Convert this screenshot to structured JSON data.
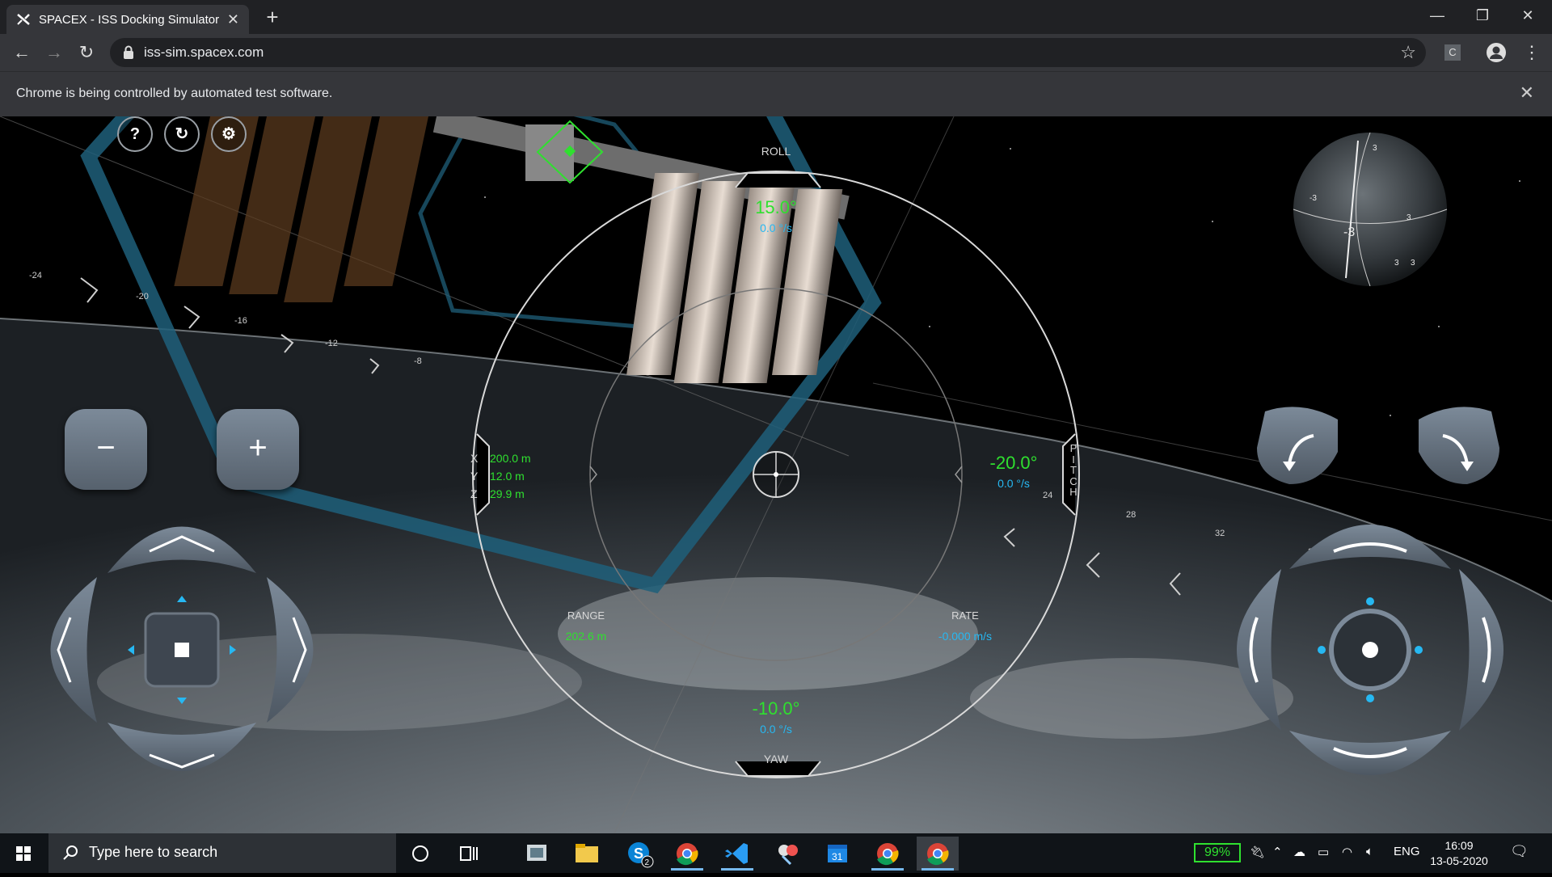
{
  "browser": {
    "tab_title": "SPACEX - ISS Docking Simulator",
    "tab_close": "✕",
    "new_tab": "+",
    "url": "iss-sim.spacex.com",
    "infobar_message": "Chrome is being controlled by automated test software.",
    "infobar_close": "✕",
    "window_controls": {
      "minimize": "—",
      "restore": "❐",
      "close": "✕"
    },
    "profile_badge": "C"
  },
  "sim": {
    "top_buttons": {
      "help": "?",
      "reset": "↻",
      "settings": "⚙"
    },
    "zoom": {
      "minus": "−",
      "plus": "+"
    },
    "roll": {
      "label": "ROLL",
      "value": "15.0°",
      "rate": "0.0 °/s"
    },
    "pitch": {
      "label_letters": [
        "P",
        "I",
        "T",
        "C",
        "H"
      ],
      "value": "-20.0°",
      "rate": "0.0 °/s"
    },
    "yaw": {
      "label": "YAW",
      "value": "-10.0°",
      "rate": "0.0 °/s"
    },
    "position": {
      "axes": [
        "X",
        "Y",
        "Z"
      ],
      "values": [
        "200.0 m",
        "12.0 m",
        "29.9 m"
      ]
    },
    "range": {
      "label": "RANGE",
      "value": "202.6 m"
    },
    "rate": {
      "label": "RATE",
      "value": "-0.000 m/s"
    },
    "scale_marks": [
      "-24",
      "-20",
      "-16",
      "-12",
      "-8",
      "24",
      "28",
      "32",
      "36"
    ],
    "globe_marks": [
      "3",
      "-3",
      "3",
      "3",
      "-3",
      "3"
    ]
  },
  "taskbar": {
    "search_placeholder": "Type here to search",
    "skype_badge": "2",
    "calendar_day": "31",
    "battery": "99%",
    "language": "ENG",
    "time": "16:09",
    "date": "13-05-2020"
  },
  "colors": {
    "hud_green": "#2fe02f",
    "hud_cyan": "#26b8f2",
    "hud_ring": "#d9d9d9",
    "hex_outline": "#1f5f7a",
    "taskbar": "#101418",
    "chrome_dark": "#202124",
    "chrome_mid": "#35363a"
  }
}
